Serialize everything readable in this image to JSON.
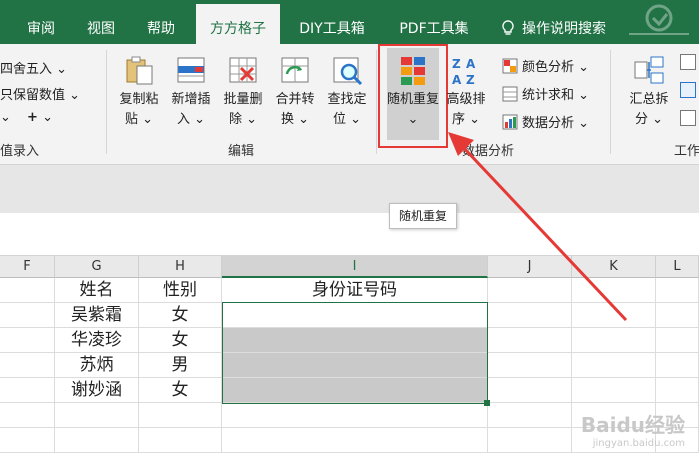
{
  "tabs": [
    "审阅",
    "视图",
    "帮助",
    "方方格子",
    "DIY工具箱",
    "PDF工具集"
  ],
  "active_tab": "方方格子",
  "tell_me": "操作说明搜索",
  "ribbon": {
    "left_items": [
      "四舍五入",
      "只保留数值",
      "值录入"
    ],
    "left_plus": "+",
    "edit_group": {
      "buttons": [
        "复制粘贴",
        "新增插入",
        "批量删除",
        "合并转换",
        "查找定位"
      ],
      "label": "编辑"
    },
    "random_repeat": "随机重复",
    "advanced_sort": "高级排序",
    "data_group": {
      "items": [
        "颜色分析",
        "统计求和",
        "数据分析"
      ],
      "label": "数据分析"
    },
    "summary_split": "汇总拆分",
    "right_label": "工作"
  },
  "tooltip": "随机重复",
  "columns": [
    "F",
    "G",
    "H",
    "I",
    "J",
    "K",
    "L"
  ],
  "table": {
    "headers": [
      "姓名",
      "性别",
      "身份证号码"
    ],
    "rows": [
      {
        "name": "吴紫霜",
        "gender": "女"
      },
      {
        "name": "华凌珍",
        "gender": "女"
      },
      {
        "name": "苏炳",
        "gender": "男"
      },
      {
        "name": "谢妙涵",
        "gender": "女"
      }
    ]
  },
  "watermark": {
    "brand": "Baidu经验",
    "url": "jingyan.baidu.com"
  },
  "colors": {
    "excel_green": "#217346",
    "highlight_red": "#e53935",
    "selected_gray": "#c9c9c9"
  }
}
